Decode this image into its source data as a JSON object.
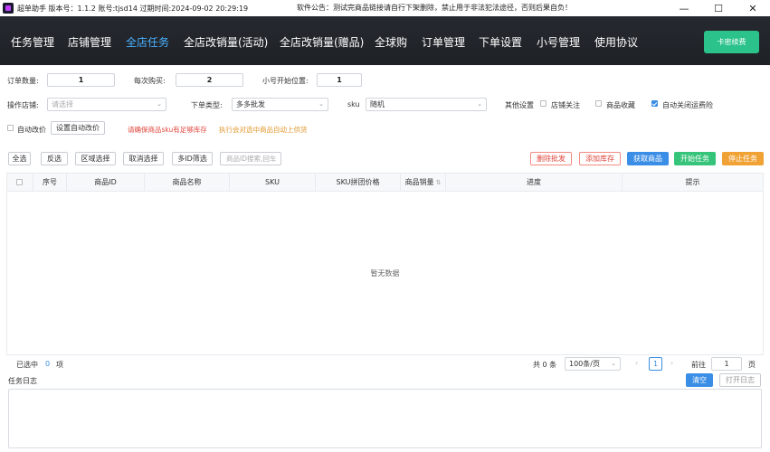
{
  "titlebar": {
    "title": "超单助手 版本号：1.1.2 账号:tjsd14 过期时间:2024-09-02 20:29:19",
    "notice": "软件公告：测试完商品链接请自行下架删除，禁止用于非法犯法途径，否则后果自负！",
    "minimize": "—",
    "maximize": "☐",
    "close": "✕"
  },
  "nav": {
    "items": [
      "任务管理",
      "店铺管理",
      "全店任务",
      "全店改销量(活动)",
      "全店改销量(赠品)",
      "全球购",
      "订单管理",
      "下单设置",
      "小号管理",
      "使用协议"
    ],
    "active_index": 2,
    "kami_button": "卡密续费"
  },
  "form": {
    "order_qty_label": "订单数量:",
    "order_qty_value": "1",
    "per_buy_label": "每次购买:",
    "per_buy_value": "2",
    "start_pos_label": "小号开始位置:",
    "start_pos_value": "1",
    "shop_label": "操作店铺:",
    "shop_placeholder": "请选择",
    "order_type_label": "下单类型:",
    "order_type_value": "多多批发",
    "sku_label": "sku",
    "sku_value": "随机",
    "other_settings_label": "其他设置",
    "shop_follow_label": "店铺关注",
    "shop_follow_checked": false,
    "goods_fav_label": "商品收藏",
    "goods_fav_checked": false,
    "auto_close_label": "自动关闭运费险",
    "auto_close_checked": true,
    "auto_price_label": "自动改价",
    "auto_price_checked": false,
    "set_auto_price_button": "设置自动改价",
    "warning_red": "请确保商品sku有足够库存",
    "warning_orange": "执行会对选中商品自动上供货"
  },
  "toolbar": {
    "select_all": "全选",
    "invert": "反选",
    "range_select": "区域选择",
    "cancel_select": "取消选择",
    "multi_id_filter": "多ID筛选",
    "search_placeholder": "商品ID搜索,回车",
    "delete_batch": "删除批发",
    "add_stock": "添加库存",
    "fetch_goods": "获取商品",
    "start_task": "开始任务",
    "stop_task": "停止任务"
  },
  "table": {
    "columns": [
      "",
      "序号",
      "商品ID",
      "商品名称",
      "SKU",
      "SKU拼团价格",
      "商品销量",
      "进度",
      "提示"
    ],
    "empty_text": "暂无数据"
  },
  "footer": {
    "selected_label": "已选中",
    "selected_count": "0",
    "selected_unit": "项",
    "total_text": "共 0 条",
    "page_size": "100条/页",
    "current_page": "1",
    "goto_label": "前往",
    "goto_value": "1",
    "page_unit": "页"
  },
  "log": {
    "title": "任务日志",
    "clear_button": "清空",
    "open_button": "打开日志"
  }
}
